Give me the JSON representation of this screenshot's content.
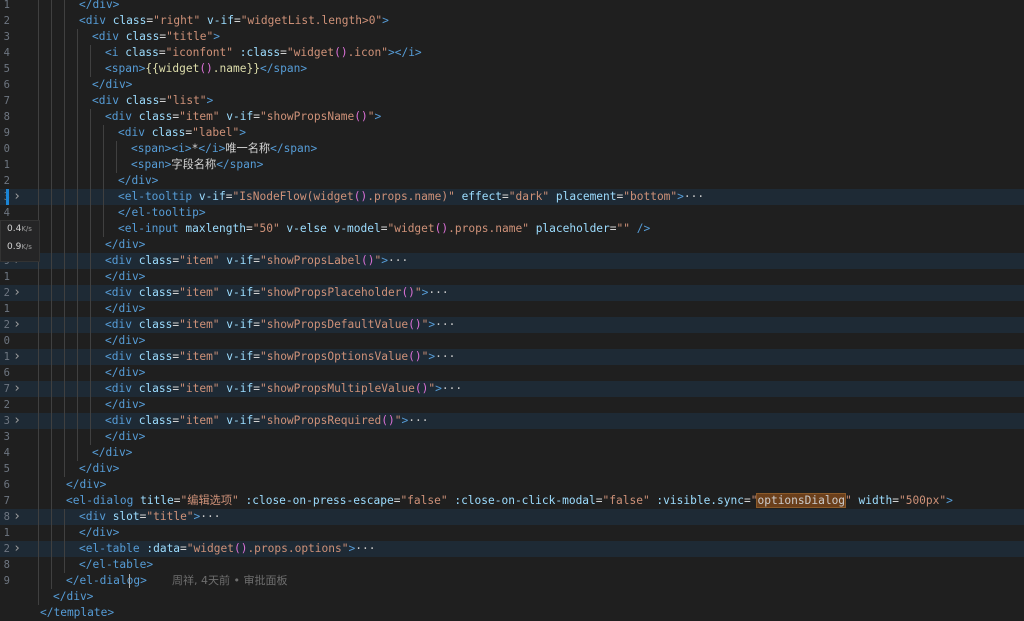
{
  "editor": {
    "lines": [
      {
        "n": "1",
        "fold": "",
        "hl": false,
        "indent": 3,
        "tokens": [
          [
            "tag",
            "</div>"
          ]
        ]
      },
      {
        "n": "2",
        "fold": "",
        "hl": false,
        "indent": 3,
        "tokens": [
          [
            "tag",
            "<div "
          ],
          [
            "attr",
            "class"
          ],
          [
            "txt",
            "="
          ],
          [
            "str",
            "\"right\""
          ],
          [
            "attr",
            " v-if"
          ],
          [
            "txt",
            "="
          ],
          [
            "str",
            "\"widgetList.length>0\""
          ],
          [
            "tag",
            ">"
          ]
        ]
      },
      {
        "n": "3",
        "fold": "",
        "hl": false,
        "indent": 4,
        "tokens": [
          [
            "tag",
            "<div "
          ],
          [
            "attr",
            "class"
          ],
          [
            "txt",
            "="
          ],
          [
            "str",
            "\"title\""
          ],
          [
            "tag",
            ">"
          ]
        ]
      },
      {
        "n": "4",
        "fold": "",
        "hl": false,
        "indent": 5,
        "tokens": [
          [
            "tag",
            "<i "
          ],
          [
            "attr",
            "class"
          ],
          [
            "txt",
            "="
          ],
          [
            "str",
            "\"iconfont\""
          ],
          [
            "attr",
            " :class"
          ],
          [
            "txt",
            "="
          ],
          [
            "str",
            "\"widget"
          ],
          [
            "paren",
            "()"
          ],
          [
            "str",
            ".icon\""
          ],
          [
            "tag",
            "></i>"
          ]
        ]
      },
      {
        "n": "5",
        "fold": "",
        "hl": false,
        "indent": 5,
        "tokens": [
          [
            "tag",
            "<span>"
          ],
          [
            "fn",
            "{{widget"
          ],
          [
            "paren",
            "()"
          ],
          [
            "fn",
            ".name}}"
          ],
          [
            "tag",
            "</span>"
          ]
        ]
      },
      {
        "n": "6",
        "fold": "",
        "hl": false,
        "indent": 4,
        "tokens": [
          [
            "tag",
            "</div>"
          ]
        ]
      },
      {
        "n": "7",
        "fold": "",
        "hl": false,
        "indent": 4,
        "tokens": [
          [
            "tag",
            "<div "
          ],
          [
            "attr",
            "class"
          ],
          [
            "txt",
            "="
          ],
          [
            "str",
            "\"list\""
          ],
          [
            "tag",
            ">"
          ]
        ]
      },
      {
        "n": "8",
        "fold": "",
        "hl": false,
        "indent": 5,
        "tokens": [
          [
            "tag",
            "<div "
          ],
          [
            "attr",
            "class"
          ],
          [
            "txt",
            "="
          ],
          [
            "str",
            "\"item\""
          ],
          [
            "attr",
            " v-if"
          ],
          [
            "txt",
            "="
          ],
          [
            "str",
            "\"showPropsName"
          ],
          [
            "paren",
            "()"
          ],
          [
            "str",
            "\""
          ],
          [
            "tag",
            ">"
          ]
        ]
      },
      {
        "n": "9",
        "fold": "",
        "hl": false,
        "indent": 6,
        "tokens": [
          [
            "tag",
            "<div "
          ],
          [
            "attr",
            "class"
          ],
          [
            "txt",
            "="
          ],
          [
            "str",
            "\"label\""
          ],
          [
            "tag",
            ">"
          ]
        ]
      },
      {
        "n": "0",
        "fold": "",
        "hl": false,
        "indent": 7,
        "tokens": [
          [
            "tag",
            "<span><i>"
          ],
          [
            "txt",
            "*"
          ],
          [
            "tag",
            "</i>"
          ],
          [
            "txt",
            "唯一名称"
          ],
          [
            "tag",
            "</span>"
          ]
        ]
      },
      {
        "n": "1",
        "fold": "",
        "hl": false,
        "indent": 7,
        "tokens": [
          [
            "tag",
            "<span>"
          ],
          [
            "txt",
            "字段名称"
          ],
          [
            "tag",
            "</span>"
          ]
        ]
      },
      {
        "n": "2",
        "fold": "",
        "hl": false,
        "indent": 6,
        "tokens": [
          [
            "tag",
            "</div>"
          ]
        ]
      },
      {
        "n": "3",
        "fold": "active",
        "hl": true,
        "indent": 6,
        "tokens": [
          [
            "tag",
            "<el-tooltip "
          ],
          [
            "attr",
            "v-if"
          ],
          [
            "txt",
            "="
          ],
          [
            "str",
            "\"IsNodeFlow(widget"
          ],
          [
            "paren",
            "()"
          ],
          [
            "str",
            ".props.name)\""
          ],
          [
            "attr",
            " effect"
          ],
          [
            "txt",
            "="
          ],
          [
            "str",
            "\"dark\""
          ],
          [
            "attr",
            " placement"
          ],
          [
            "txt",
            "="
          ],
          [
            "str",
            "\"bottom\""
          ],
          [
            "tag",
            ">"
          ],
          [
            "ellipsis",
            "···"
          ]
        ]
      },
      {
        "n": "4",
        "fold": "",
        "hl": false,
        "indent": 6,
        "tokens": [
          [
            "tag",
            "</el-tooltip>"
          ]
        ]
      },
      {
        "n": "5",
        "fold": "",
        "hl": false,
        "indent": 6,
        "tokens": [
          [
            "tag",
            "<el-input "
          ],
          [
            "attr",
            "maxlength"
          ],
          [
            "txt",
            "="
          ],
          [
            "str",
            "\"50\""
          ],
          [
            "attr",
            " v-else"
          ],
          [
            "attr",
            " v-model"
          ],
          [
            "txt",
            "="
          ],
          [
            "str",
            "\"widget"
          ],
          [
            "paren",
            "()"
          ],
          [
            "str",
            ".props.name\""
          ],
          [
            "attr",
            " placeholder"
          ],
          [
            "txt",
            "="
          ],
          [
            "str",
            "\"\""
          ],
          [
            "tag",
            " />"
          ]
        ]
      },
      {
        "n": "6",
        "fold": "",
        "hl": false,
        "indent": 5,
        "tokens": [
          [
            "tag",
            "</div>"
          ]
        ]
      },
      {
        "n": "9",
        "fold": ">",
        "hl": true,
        "indent": 5,
        "tokens": [
          [
            "tag",
            "<div "
          ],
          [
            "attr",
            "class"
          ],
          [
            "txt",
            "="
          ],
          [
            "str",
            "\"item\""
          ],
          [
            "attr",
            " v-if"
          ],
          [
            "txt",
            "="
          ],
          [
            "str",
            "\"showPropsLabel"
          ],
          [
            "paren",
            "()"
          ],
          [
            "str",
            "\""
          ],
          [
            "tag",
            ">"
          ],
          [
            "ellipsis",
            "···"
          ]
        ]
      },
      {
        "n": "1",
        "fold": "",
        "hl": false,
        "indent": 5,
        "tokens": [
          [
            "tag",
            "</div>"
          ]
        ]
      },
      {
        "n": "2",
        "fold": ">",
        "hl": true,
        "indent": 5,
        "tokens": [
          [
            "tag",
            "<div "
          ],
          [
            "attr",
            "class"
          ],
          [
            "txt",
            "="
          ],
          [
            "str",
            "\"item\""
          ],
          [
            "attr",
            " v-if"
          ],
          [
            "txt",
            "="
          ],
          [
            "str",
            "\"showPropsPlaceholder"
          ],
          [
            "paren",
            "()"
          ],
          [
            "str",
            "\""
          ],
          [
            "tag",
            ">"
          ],
          [
            "ellipsis",
            "···"
          ]
        ]
      },
      {
        "n": "1",
        "fold": "",
        "hl": false,
        "indent": 5,
        "tokens": [
          [
            "tag",
            "</div>"
          ]
        ]
      },
      {
        "n": "2",
        "fold": ">",
        "hl": true,
        "indent": 5,
        "tokens": [
          [
            "tag",
            "<div "
          ],
          [
            "attr",
            "class"
          ],
          [
            "txt",
            "="
          ],
          [
            "str",
            "\"item\""
          ],
          [
            "attr",
            " v-if"
          ],
          [
            "txt",
            "="
          ],
          [
            "str",
            "\"showPropsDefaultValue"
          ],
          [
            "paren",
            "()"
          ],
          [
            "str",
            "\""
          ],
          [
            "tag",
            ">"
          ],
          [
            "ellipsis",
            "···"
          ]
        ]
      },
      {
        "n": "0",
        "fold": "",
        "hl": false,
        "indent": 5,
        "tokens": [
          [
            "tag",
            "</div>"
          ]
        ]
      },
      {
        "n": "1",
        "fold": ">",
        "hl": true,
        "indent": 5,
        "tokens": [
          [
            "tag",
            "<div "
          ],
          [
            "attr",
            "class"
          ],
          [
            "txt",
            "="
          ],
          [
            "str",
            "\"item\""
          ],
          [
            "attr",
            " v-if"
          ],
          [
            "txt",
            "="
          ],
          [
            "str",
            "\"showPropsOptionsValue"
          ],
          [
            "paren",
            "()"
          ],
          [
            "str",
            "\""
          ],
          [
            "tag",
            ">"
          ],
          [
            "ellipsis",
            "···"
          ]
        ]
      },
      {
        "n": "6",
        "fold": "",
        "hl": false,
        "indent": 5,
        "tokens": [
          [
            "tag",
            "</div>"
          ]
        ]
      },
      {
        "n": "7",
        "fold": ">",
        "hl": true,
        "indent": 5,
        "tokens": [
          [
            "tag",
            "<div "
          ],
          [
            "attr",
            "class"
          ],
          [
            "txt",
            "="
          ],
          [
            "str",
            "\"item\""
          ],
          [
            "attr",
            " v-if"
          ],
          [
            "txt",
            "="
          ],
          [
            "str",
            "\"showPropsMultipleValue"
          ],
          [
            "paren",
            "()"
          ],
          [
            "str",
            "\""
          ],
          [
            "tag",
            ">"
          ],
          [
            "ellipsis",
            "···"
          ]
        ]
      },
      {
        "n": "2",
        "fold": "",
        "hl": false,
        "indent": 5,
        "tokens": [
          [
            "tag",
            "</div>"
          ]
        ]
      },
      {
        "n": "3",
        "fold": ">",
        "hl": true,
        "indent": 5,
        "tokens": [
          [
            "tag",
            "<div "
          ],
          [
            "attr",
            "class"
          ],
          [
            "txt",
            "="
          ],
          [
            "str",
            "\"item\""
          ],
          [
            "attr",
            " v-if"
          ],
          [
            "txt",
            "="
          ],
          [
            "str",
            "\"showPropsRequired"
          ],
          [
            "paren",
            "()"
          ],
          [
            "str",
            "\""
          ],
          [
            "tag",
            ">"
          ],
          [
            "ellipsis",
            "···"
          ]
        ]
      },
      {
        "n": "3",
        "fold": "",
        "hl": false,
        "indent": 5,
        "tokens": [
          [
            "tag",
            "</div>"
          ]
        ]
      },
      {
        "n": "4",
        "fold": "",
        "hl": false,
        "indent": 4,
        "tokens": [
          [
            "tag",
            "</div>"
          ]
        ]
      },
      {
        "n": "5",
        "fold": "",
        "hl": false,
        "indent": 3,
        "tokens": [
          [
            "tag",
            "</div>"
          ]
        ]
      },
      {
        "n": "6",
        "fold": "",
        "hl": false,
        "indent": 2,
        "tokens": [
          [
            "tag",
            "</div>"
          ]
        ]
      },
      {
        "n": "7",
        "fold": "",
        "hl": false,
        "indent": 2,
        "tokens": [
          [
            "tag",
            "<el-dialog "
          ],
          [
            "attr",
            "title"
          ],
          [
            "txt",
            "="
          ],
          [
            "str",
            "\"编辑选项\""
          ],
          [
            "attr",
            " :close-on-press-escape"
          ],
          [
            "txt",
            "="
          ],
          [
            "str",
            "\"false\""
          ],
          [
            "attr",
            " :close-on-click-modal"
          ],
          [
            "txt",
            "="
          ],
          [
            "str",
            "\"false\""
          ],
          [
            "attr",
            " :visible.sync"
          ],
          [
            "txt",
            "="
          ],
          [
            "str",
            "\""
          ],
          [
            "sel",
            "optionsDialog"
          ],
          [
            "str",
            "\""
          ],
          [
            "attr",
            " width"
          ],
          [
            "txt",
            "="
          ],
          [
            "str",
            "\"500px\""
          ],
          [
            "tag",
            ">"
          ]
        ]
      },
      {
        "n": "8",
        "fold": ">",
        "hl": true,
        "indent": 3,
        "tokens": [
          [
            "tag",
            "<div "
          ],
          [
            "attr",
            "slot"
          ],
          [
            "txt",
            "="
          ],
          [
            "str",
            "\"title\""
          ],
          [
            "tag",
            ">"
          ],
          [
            "ellipsis",
            "···"
          ]
        ]
      },
      {
        "n": "1",
        "fold": "",
        "hl": false,
        "indent": 3,
        "tokens": [
          [
            "tag",
            "</div>"
          ]
        ]
      },
      {
        "n": "2",
        "fold": ">",
        "hl": true,
        "indent": 3,
        "tokens": [
          [
            "tag",
            "<el-table "
          ],
          [
            "attr",
            ":data"
          ],
          [
            "txt",
            "="
          ],
          [
            "str",
            "\"widget"
          ],
          [
            "paren",
            "()"
          ],
          [
            "str",
            ".props.options\""
          ],
          [
            "tag",
            ">"
          ],
          [
            "ellipsis",
            "···"
          ]
        ]
      },
      {
        "n": "8",
        "fold": "",
        "hl": false,
        "indent": 3,
        "tokens": [
          [
            "tag",
            "</el-table>"
          ]
        ]
      },
      {
        "n": "9",
        "fold": "",
        "hl": false,
        "indent": 2,
        "tokens": [
          [
            "tag",
            "</el-dialog>"
          ]
        ]
      },
      {
        "n": "",
        "fold": "",
        "hl": false,
        "indent": 1,
        "tokens": [
          [
            "tag",
            "</div>"
          ]
        ]
      },
      {
        "n": "",
        "fold": "",
        "hl": false,
        "indent": 0,
        "tokens": [
          [
            "tag",
            "</template>"
          ]
        ]
      }
    ],
    "blame": "周祥, 4天前 • 审批面板",
    "net": {
      "up": "0.4",
      "up_unit": "K/s",
      "down": "0.9",
      "down_unit": "K/s"
    }
  }
}
